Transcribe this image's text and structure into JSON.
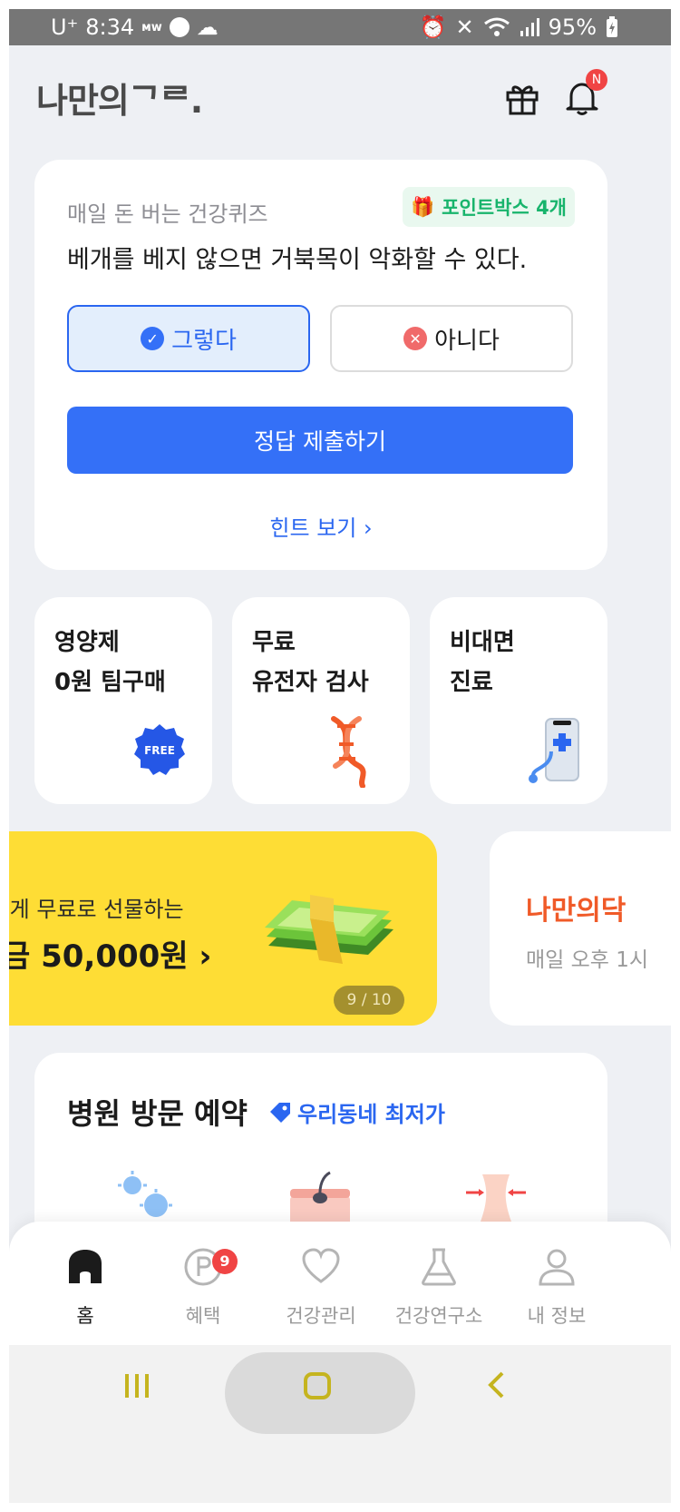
{
  "status_bar": {
    "carrier": "U⁺",
    "time": "8:34",
    "mw": "ᴍᴡ",
    "battery": "95%"
  },
  "header": {
    "logo": "나만의ᄀᄅ.",
    "notif_badge": "N"
  },
  "quiz": {
    "label": "매일 돈 버는 건강퀴즈",
    "point_box": "포인트박스 4개",
    "question": "베개를 베지 않으면 거북목이 악화할 수 있다.",
    "yes_label": "그렇다",
    "no_label": "아니다",
    "submit_label": "정답 제출하기",
    "hint_label": "힌트 보기 ›"
  },
  "features": [
    {
      "line1": "영양제",
      "line2": "0원 팀구매",
      "badge": "FREE"
    },
    {
      "line1": "무료",
      "line2": "유전자 검사"
    },
    {
      "line1": "비대면",
      "line2": "진료"
    }
  ],
  "banner": {
    "line1": "l게 무료로 선물하는",
    "line2": "금 50,000원  ›",
    "pager": "9 / 10"
  },
  "banner2": {
    "title": "나만의닥",
    "subtitle": "매일 오후 1시"
  },
  "hospital": {
    "title": "병원 방문 예약",
    "tag": "우리동네 최저가"
  },
  "nav": {
    "items": [
      {
        "label": "홈"
      },
      {
        "label": "혜택",
        "badge": "9"
      },
      {
        "label": "건강관리"
      },
      {
        "label": "건강연구소"
      },
      {
        "label": "내 정보"
      }
    ]
  },
  "colors": {
    "accent": "#3470f7",
    "banner": "#fedd35",
    "badge": "#f04444",
    "point_green": "#18b46c",
    "system_nav_icon": "#c5b41f"
  }
}
